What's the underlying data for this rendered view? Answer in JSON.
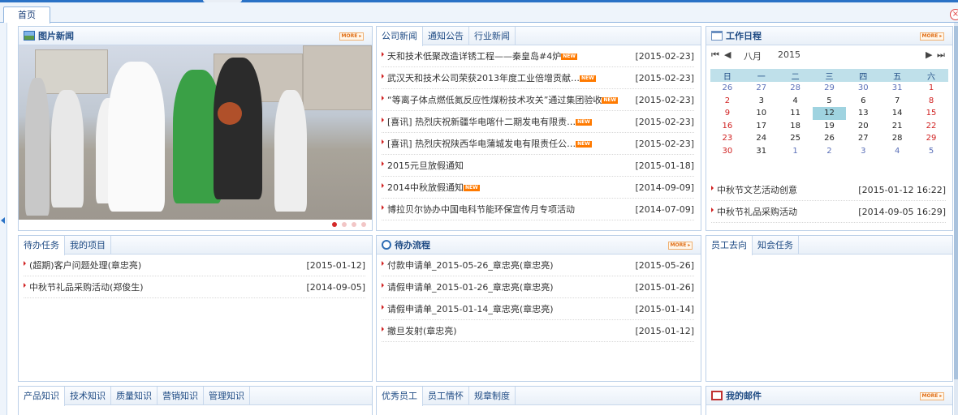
{
  "main_tab": "首页",
  "close_symbol": "×",
  "photo_news": {
    "title": "图片新闻",
    "more": "MORE ▸",
    "slides": 4,
    "active_slide": 1
  },
  "company_news": {
    "tabs": [
      "公司新闻",
      "通知公告",
      "行业新闻"
    ],
    "items": [
      {
        "title": "天和技术低聚改造详锈工程——秦皇岛#4炉",
        "new": true,
        "date": "[2015-02-23]"
      },
      {
        "title": "武汉天和技术公司荣获2013年度工业倍增贡献…",
        "new": true,
        "date": "[2015-02-23]"
      },
      {
        "title": "“等离子体点燃低氮反应性煤粉技术攻关”通过集团验收",
        "new": true,
        "date": "[2015-02-23]"
      },
      {
        "title": "[喜讯] 热烈庆祝新疆华电喀什二期发电有限责…",
        "new": true,
        "date": "[2015-02-23]"
      },
      {
        "title": "[喜讯] 热烈庆祝陕西华电蒲城发电有限责任公…",
        "new": true,
        "date": "[2015-02-23]"
      },
      {
        "title": "2015元旦放假通知",
        "new": false,
        "date": "[2015-01-18]"
      },
      {
        "title": "2014中秋放假通知",
        "new": true,
        "date": "[2014-09-09]"
      },
      {
        "title": "博拉贝尔协办中国电科节能环保宣传月专项活动",
        "new": false,
        "date": "[2014-07-09]"
      }
    ]
  },
  "schedule": {
    "title": "工作日程",
    "more": "MORE ▸",
    "nav": {
      "first": "⏮",
      "prev": "◀",
      "next": "▶",
      "last": "⏭",
      "month": "八月",
      "year": "2015"
    },
    "weekdays": [
      "日",
      "一",
      "二",
      "三",
      "四",
      "五",
      "六"
    ],
    "weeks": [
      [
        "26",
        "27",
        "28",
        "29",
        "30",
        "31",
        "1"
      ],
      [
        "2",
        "3",
        "4",
        "5",
        "6",
        "7",
        "8"
      ],
      [
        "9",
        "10",
        "11",
        "12",
        "13",
        "14",
        "15"
      ],
      [
        "16",
        "17",
        "18",
        "19",
        "20",
        "21",
        "22"
      ],
      [
        "23",
        "24",
        "25",
        "26",
        "27",
        "28",
        "29"
      ],
      [
        "30",
        "31",
        "1",
        "2",
        "3",
        "4",
        "5"
      ]
    ],
    "selected": "12",
    "items": [
      {
        "title": "中秋节文艺活动创意",
        "date": "[2015-01-12 16:22]"
      },
      {
        "title": "中秋节礼品采购活动",
        "date": "[2014-09-05 16:29]"
      }
    ]
  },
  "tasks": {
    "tabs": [
      "待办任务",
      "我的项目"
    ],
    "items": [
      {
        "title": "(超期)客户问题处理(章忠亮)",
        "date": "[2015-01-12]"
      },
      {
        "title": "中秋节礼品采购活动(郑俊生)",
        "date": "[2014-09-05]"
      }
    ]
  },
  "flow": {
    "title": "待办流程",
    "more": "MORE ▸",
    "items": [
      {
        "title": "付款申请单_2015-05-26_章忠亮(章忠亮)",
        "date": "[2015-05-26]"
      },
      {
        "title": "请假申请单_2015-01-26_章忠亮(章忠亮)",
        "date": "[2015-01-26]"
      },
      {
        "title": "请假申请单_2015-01-14_章忠亮(章忠亮)",
        "date": "[2015-01-14]"
      },
      {
        "title": "撤旦发射(章忠亮)",
        "date": "[2015-01-12]"
      }
    ]
  },
  "staff": {
    "tabs": [
      "员工去向",
      "知会任务"
    ]
  },
  "knowledge": {
    "tabs": [
      "产品知识",
      "技术知识",
      "质量知识",
      "营销知识",
      "管理知识"
    ]
  },
  "excellent": {
    "tabs": [
      "优秀员工",
      "员工情怀",
      "规章制度"
    ]
  },
  "mail": {
    "title": "我的邮件",
    "more": "MORE ▸"
  }
}
